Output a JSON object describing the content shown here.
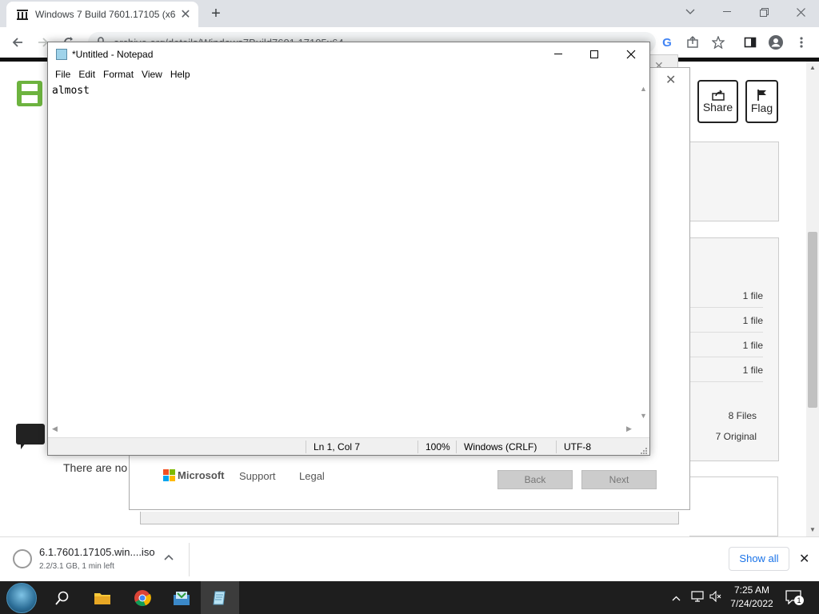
{
  "browser": {
    "tab_title": "Windows 7 Build 7601.17105 (x6",
    "url": "archive.org/details/Windows7Build7601.17105x64"
  },
  "page": {
    "share_label": "Share",
    "flag_label": "Flag",
    "file_counts": [
      "1 file",
      "1 file",
      "1 file",
      "1 file"
    ],
    "files_total": "8 Files",
    "original_total": "7 Original",
    "partial_text": "There are no"
  },
  "setup_dialog": {
    "brand": "Microsoft",
    "support_link": "Support",
    "legal_link": "Legal",
    "back_button": "Back",
    "next_button": "Next"
  },
  "notepad": {
    "title": "*Untitled - Notepad",
    "menu": [
      "File",
      "Edit",
      "Format",
      "View",
      "Help"
    ],
    "content": "almost",
    "status": {
      "position": "Ln 1, Col 7",
      "zoom": "100%",
      "line_ending": "Windows (CRLF)",
      "encoding": "UTF-8"
    }
  },
  "download": {
    "filename": "6.1.7601.17105.win....iso",
    "progress": "2.2/3.1 GB, 1 min left",
    "show_all": "Show all"
  },
  "taskbar": {
    "apps": [
      "start-icon",
      "search-icon",
      "file-explorer-icon",
      "chrome-icon",
      "setup-icon",
      "notepad-icon"
    ],
    "time": "7:25 AM",
    "date": "7/24/2022",
    "notification_count": "1"
  }
}
